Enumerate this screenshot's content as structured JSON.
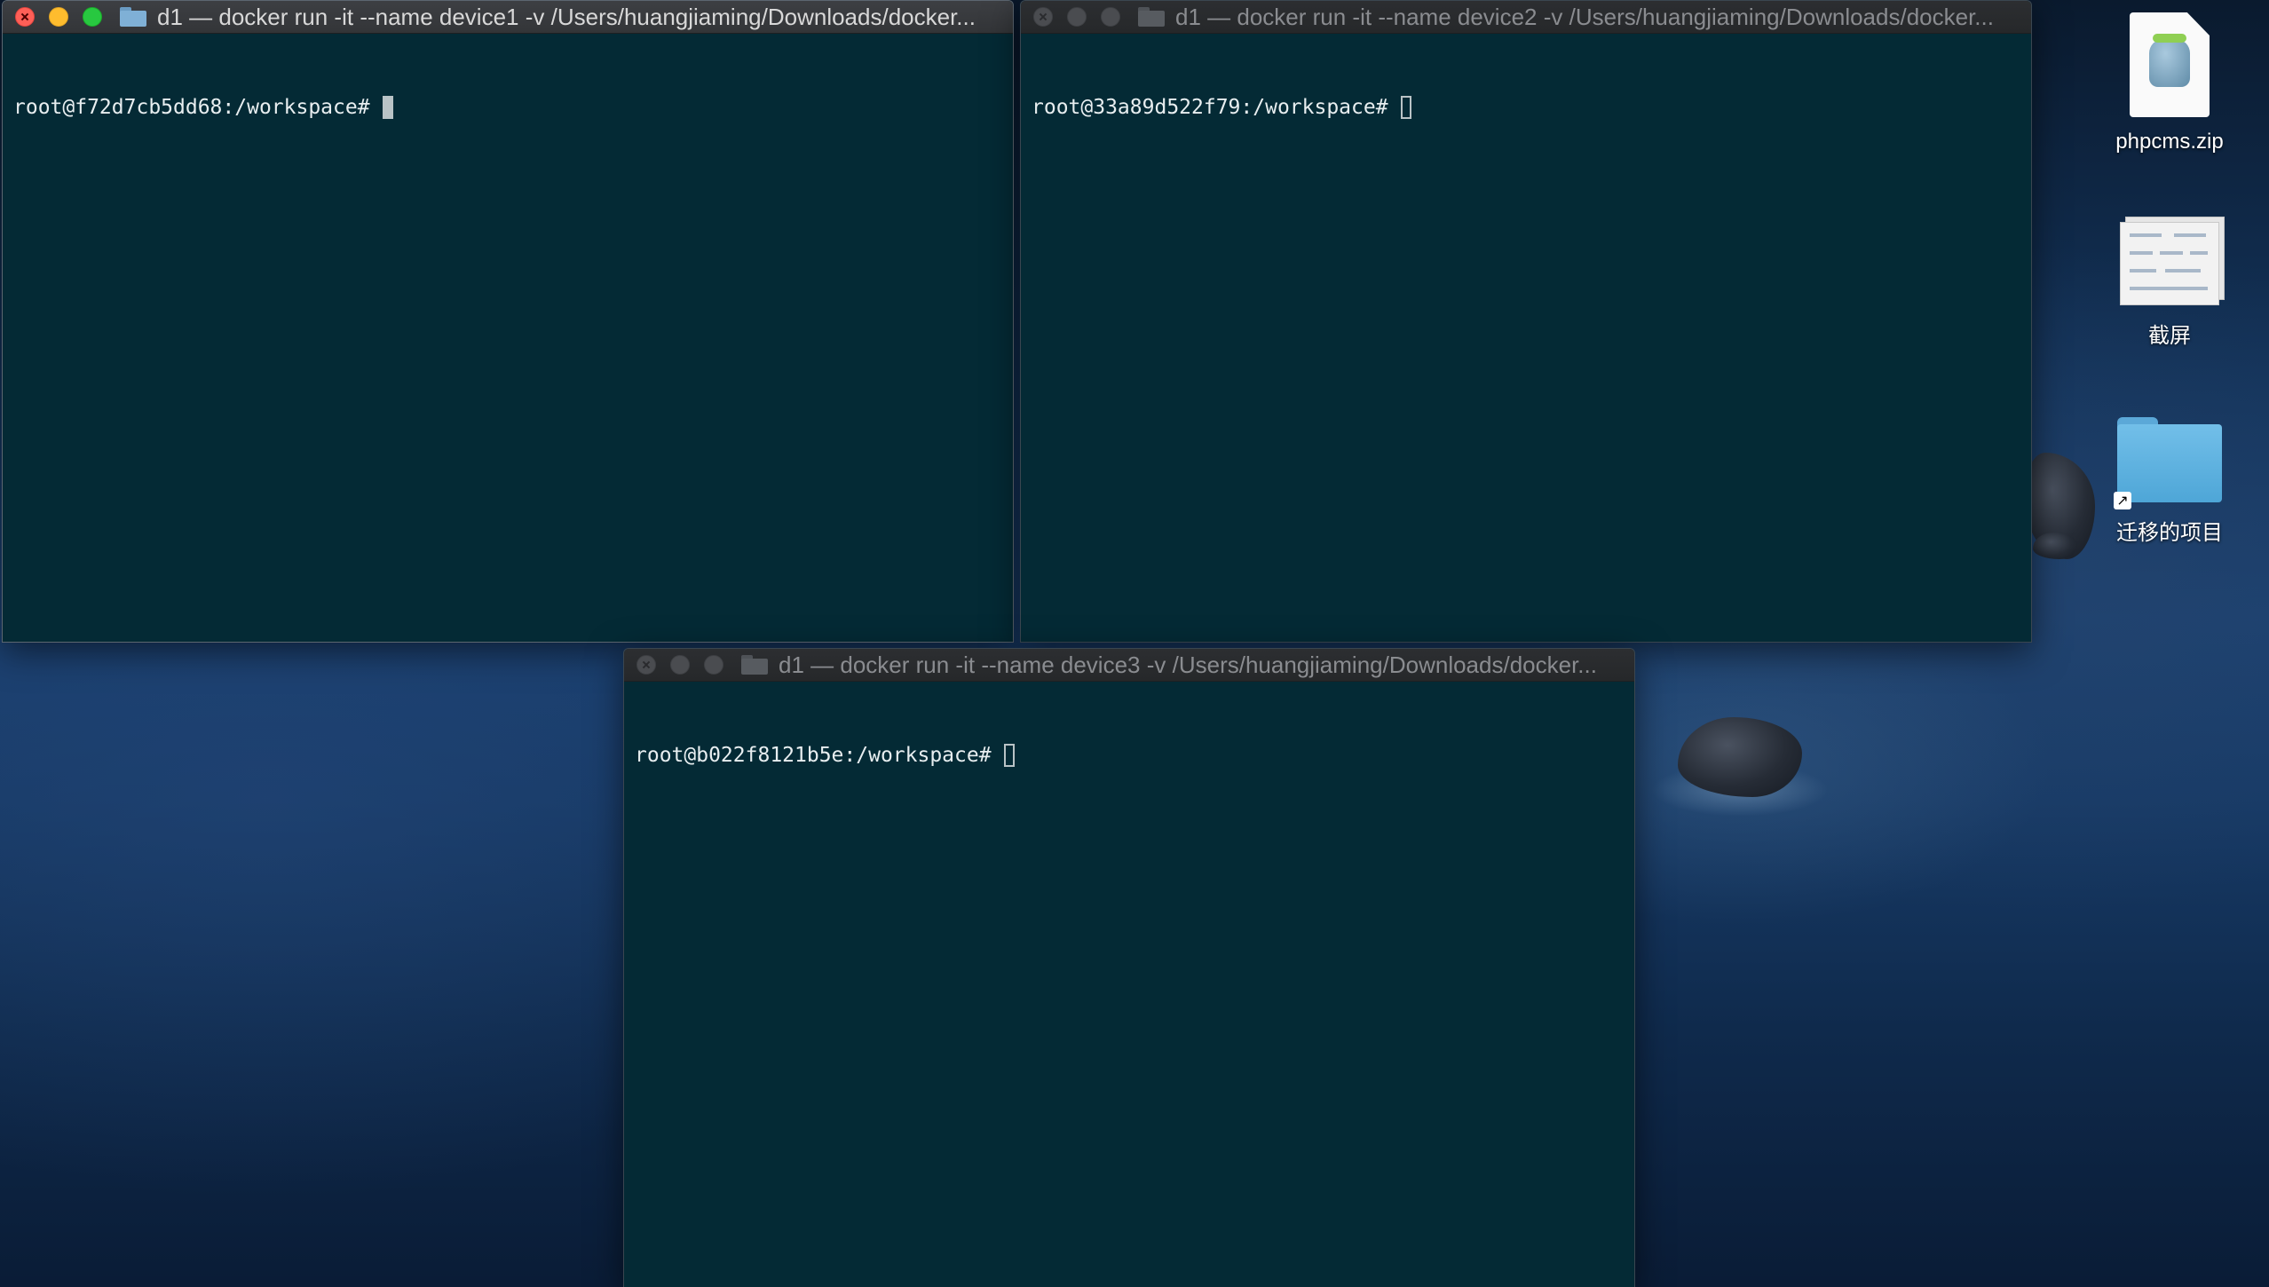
{
  "windows": [
    {
      "id": "win1",
      "title": "d1 — docker run -it --name device1 -v /Users/huangjiaming/Downloads/docker...",
      "prompt": "root@f72d7cb5dd68:/workspace#",
      "focused": true
    },
    {
      "id": "win2",
      "title": "d1 — docker run -it --name device2 -v /Users/huangjiaming/Downloads/docker...",
      "prompt": "root@33a89d522f79:/workspace#",
      "focused": false
    },
    {
      "id": "win3",
      "title": "d1 — docker run -it --name device3 -v /Users/huangjiaming/Downloads/docker...",
      "prompt": "root@b022f8121b5e:/workspace#",
      "focused": false
    }
  ],
  "desktop_icons": {
    "zip": {
      "label": "phpcms.zip",
      "icon": "zip-archive-icon"
    },
    "screenshot": {
      "label": "截屏",
      "icon": "screenshot-file-icon"
    },
    "folder": {
      "label": "迁移的项目",
      "icon": "folder-alias-icon"
    }
  },
  "colors": {
    "terminal_bg": "#042a35",
    "close": "#ff5f57",
    "minimize": "#febc2e",
    "maximize": "#28c840"
  }
}
